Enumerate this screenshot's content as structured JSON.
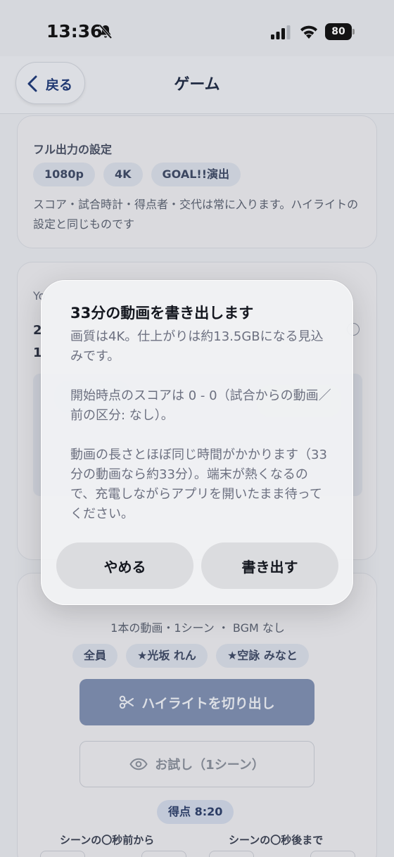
{
  "status_bar": {
    "time": "13:36",
    "battery": "80"
  },
  "nav": {
    "back_label": "戻る",
    "title": "ゲーム"
  },
  "full_output": {
    "title": "フル出力の設定",
    "chips": [
      "1080p",
      "4K",
      "GOAL!!演出"
    ],
    "description": "スコア・試合時計・得点者・交代は常に入ります。ハイライトの設定と同じものです"
  },
  "partial_card": {
    "frag_a": "Yo",
    "frag_b": "2",
    "frag_c": "1"
  },
  "highlight": {
    "meta": "1本の動画・1シーン ・ BGM なし",
    "chips": [
      "全員",
      "★光坂 れん",
      "★空詠 みなと"
    ],
    "cut_button": "ハイライトを切り出し",
    "preview_button": "お試し（1シーン）",
    "score_badge": "得点 8:20",
    "before_label": "シーンの〇秒前から",
    "after_label": "シーンの〇秒後まで"
  },
  "dialog": {
    "title": "33分の動画を書き出します",
    "paragraphs": [
      "画質は4K。仕上がりは約13.5GBになる見込みです。",
      "開始時点のスコアは 0 - 0（試合からの動画／前の区分: なし）。",
      "動画の長さとほぼ同じ時間がかかります（33分の動画なら約33分）。端末が熱くなるので、充電しながらアプリを開いたまま待ってください。"
    ],
    "cancel_label": "やめる",
    "export_label": "書き出す"
  }
}
